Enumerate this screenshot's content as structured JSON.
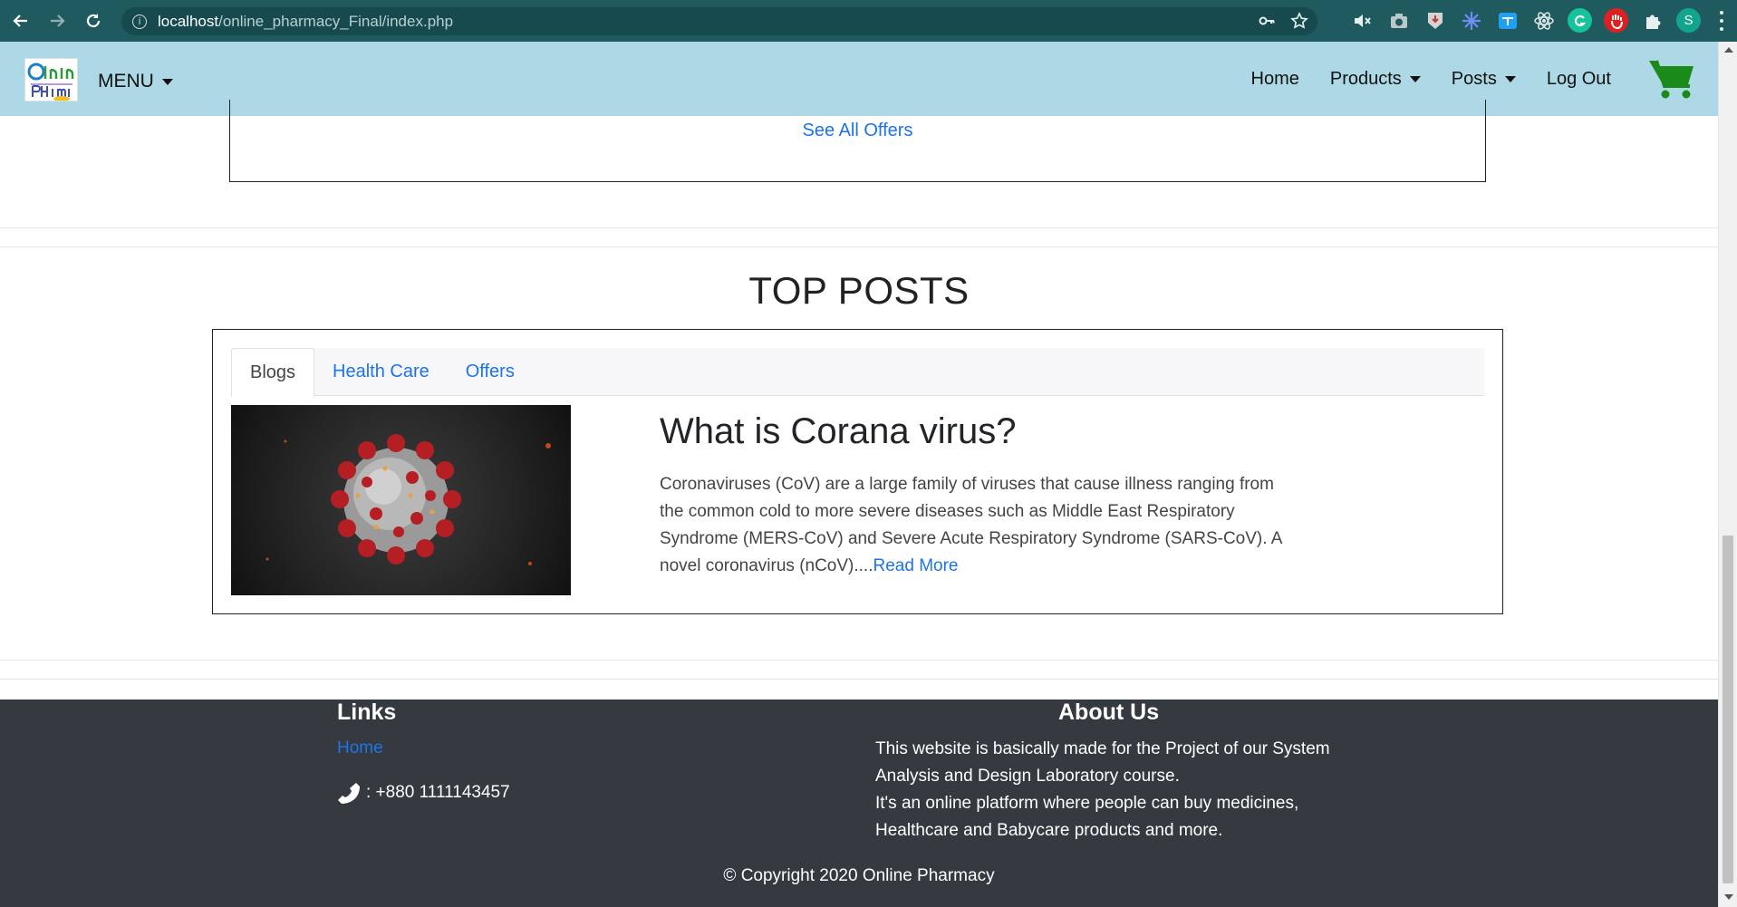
{
  "browser": {
    "url_host": "localhost",
    "url_path": "/online_pharmacy_Final/index.php",
    "profile_initial": "S"
  },
  "navbar": {
    "logo_text_top": "Online",
    "logo_text_bottom": "Pharmacy",
    "menu_label": "MENU",
    "links": [
      "Home",
      "Products",
      "Posts",
      "Log Out"
    ],
    "cart_icon": "shopping-cart-icon",
    "background_color": "#add8e6"
  },
  "offers": {
    "see_all_label": "See All Offers"
  },
  "top_posts": {
    "title": "TOP POSTS",
    "tabs": [
      "Blogs",
      "Health Care",
      "Offers"
    ],
    "active_tab": "Blogs",
    "post": {
      "title": "What is Corana virus?",
      "body": "Coronaviruses (CoV) are a large family of viruses that cause illness ranging from the common cold to more severe diseases such as Middle East Respiratory Syndrome (MERS-CoV) and Severe Acute Respiratory Syndrome (SARS-CoV). A novel coronavirus (nCoV)....",
      "read_more": "Read More"
    }
  },
  "footer": {
    "links_title": "Links",
    "home_link": "Home",
    "phone": ": +880 1111143457",
    "about_title": "About Us",
    "about_text_1": "This website is basically made for the Project of our System Analysis and Design Laboratory course.",
    "about_text_2": "It's an online platform where people can buy medicines, Healthcare and Babycare products and more.",
    "copyright": "© Copyright 2020 Online Pharmacy"
  },
  "colors": {
    "link_blue": "#1c74e9",
    "footer_bg": "#343a40",
    "chrome_bg": "#1e5a5e",
    "cart_green": "#1a8a1a"
  }
}
